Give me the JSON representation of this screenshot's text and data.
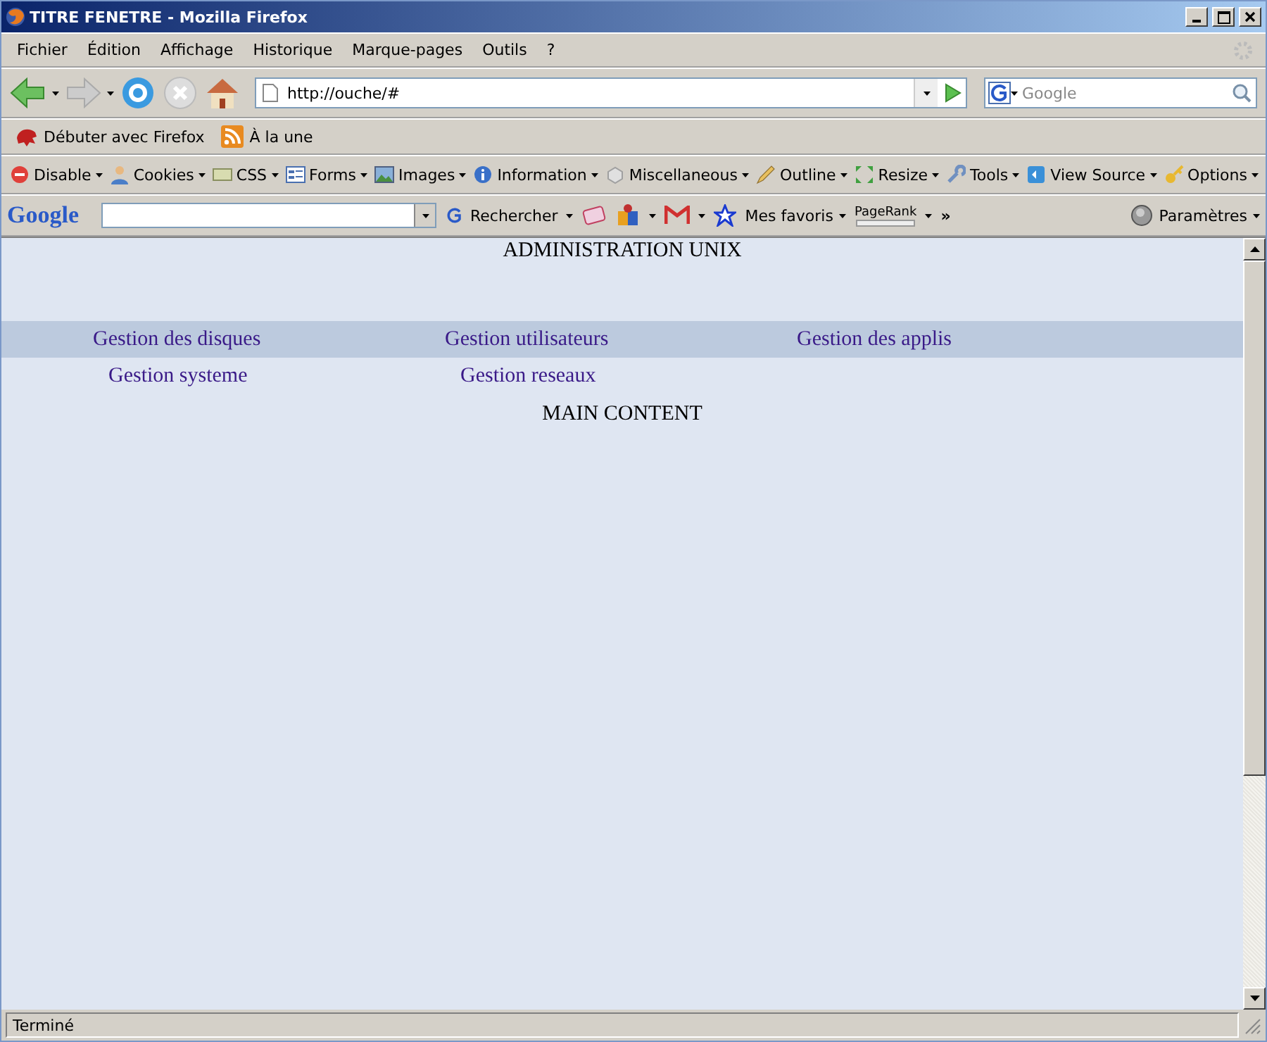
{
  "window": {
    "title": "TITRE FENETRE - Mozilla Firefox"
  },
  "menu": [
    "Fichier",
    "Édition",
    "Affichage",
    "Historique",
    "Marque-pages",
    "Outils",
    "?"
  ],
  "navigation": {
    "url": "http://ouche/#",
    "search_placeholder": "Google"
  },
  "bookmarks": [
    {
      "label": "Débuter avec Firefox",
      "kind": "page"
    },
    {
      "label": "À la une",
      "kind": "feed"
    }
  ],
  "developer_toolbar": [
    {
      "label": "Disable",
      "kind": "disable"
    },
    {
      "label": "Cookies",
      "kind": "cookies"
    },
    {
      "label": "CSS",
      "kind": "css"
    },
    {
      "label": "Forms",
      "kind": "forms"
    },
    {
      "label": "Images",
      "kind": "images"
    },
    {
      "label": "Information",
      "kind": "info"
    },
    {
      "label": "Miscellaneous",
      "kind": "misc"
    },
    {
      "label": "Outline",
      "kind": "outline"
    },
    {
      "label": "Resize",
      "kind": "resize"
    },
    {
      "label": "Tools",
      "kind": "tools"
    },
    {
      "label": "View Source",
      "kind": "source"
    },
    {
      "label": "Options",
      "kind": "options"
    }
  ],
  "google_toolbar": {
    "logo": "Google",
    "search_button": "Rechercher",
    "favorites": "Mes favoris",
    "pagerank": "PageRank",
    "more": "»",
    "settings": "Paramètres"
  },
  "page": {
    "heading": "ADMINISTRATION UNIX",
    "nav_rows": [
      [
        "Gestion des disques",
        "Gestion utilisateurs",
        "Gestion des applis"
      ],
      [
        "Gestion systeme",
        "Gestion reseaux"
      ]
    ],
    "main_content": "MAIN CONTENT"
  },
  "status_bar": "Terminé"
}
